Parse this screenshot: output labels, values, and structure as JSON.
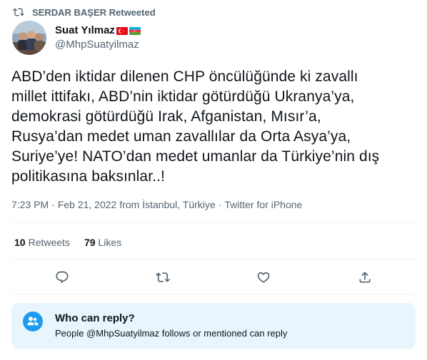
{
  "retweet_header": {
    "label": "SERDAR BAŞER Retweeted",
    "icon": "retweet-icon"
  },
  "author": {
    "name": "Suat Yılmaz",
    "handle": "@MhpSuatyilmaz",
    "flags": [
      "turkey-flag",
      "azerbaijan-flag"
    ]
  },
  "tweet": {
    "lines": [
      "ABD’den iktidar dilenen CHP öncülüğünde ki zavallı",
      "millet ittifakı, ABD’nin iktidar götürdüğü Ukranya’ya,",
      "demokrasi götürdüğü Irak, Afganistan, Mısır’a,",
      "Rusya’dan medet uman zavallılar da Orta Asya’ya,",
      "Suriye’ye! NATO’dan medet umanlar da Türkiye’nin dış",
      "politikasına baksınlar..!"
    ]
  },
  "meta": {
    "time": "7:23 PM",
    "date": "Feb 21, 2022",
    "location": "from İstanbul, Türkiye",
    "source": "Twitter for iPhone",
    "separator": "·"
  },
  "stats": {
    "retweets_count": "10",
    "retweets_label": "Retweets",
    "likes_count": "79",
    "likes_label": "Likes"
  },
  "actions": [
    "reply-icon",
    "retweet-icon",
    "like-icon",
    "share-icon"
  ],
  "reply_card": {
    "title": "Who can reply?",
    "description": "People @MhpSuatyilmaz follows or mentioned can reply",
    "icon": "people-icon"
  },
  "colors": {
    "text": "#0f1419",
    "secondary": "#536471",
    "accent": "#1d9bf0",
    "card_bg": "#e8f5fd",
    "divider": "#eff3f4"
  }
}
